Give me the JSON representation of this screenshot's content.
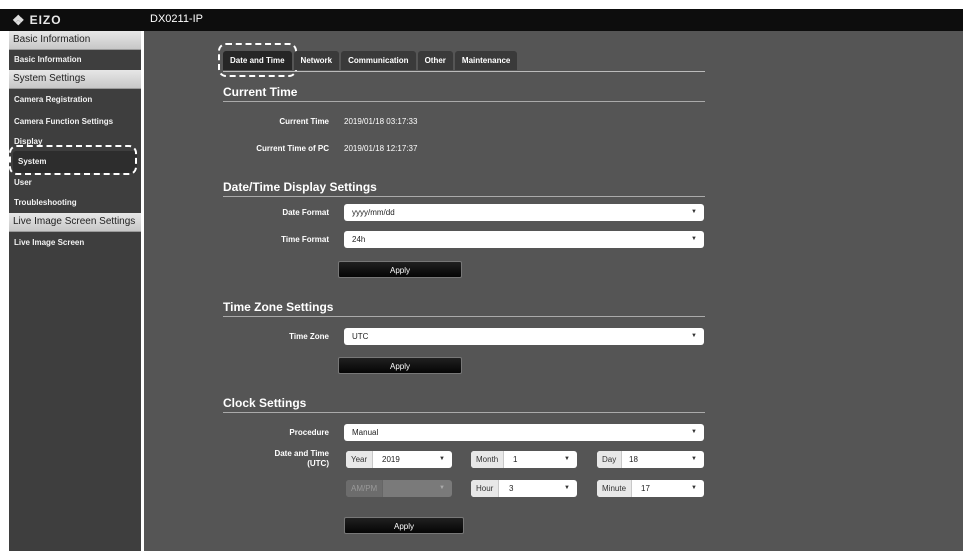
{
  "header": {
    "logo_text": "EIZO",
    "device_name": "DX0211-IP"
  },
  "sidebar": {
    "groups": [
      {
        "title": "Basic Information",
        "items": [
          "Basic Information"
        ]
      },
      {
        "title": "System Settings",
        "items": [
          "Camera Registration",
          "Camera Function Settings",
          "Display",
          "System",
          "User",
          "Troubleshooting"
        ]
      },
      {
        "title": "Live Image Screen Settings",
        "items": [
          "Live Image Screen"
        ]
      }
    ],
    "active_item": "System"
  },
  "tabs": [
    {
      "label": "Date and Time",
      "active": true
    },
    {
      "label": "Network",
      "active": false
    },
    {
      "label": "Communication",
      "active": false
    },
    {
      "label": "Other",
      "active": false
    },
    {
      "label": "Maintenance",
      "active": false
    }
  ],
  "current_time": {
    "title": "Current Time",
    "current_time_label": "Current Time",
    "current_time_value": "2019/01/18 03:17:33",
    "pc_time_label": "Current Time of PC",
    "pc_time_value": "2019/01/18 12:17:37"
  },
  "display_settings": {
    "title": "Date/Time Display Settings",
    "date_format_label": "Date Format",
    "date_format_value": "yyyy/mm/dd",
    "time_format_label": "Time Format",
    "time_format_value": "24h",
    "apply_label": "Apply"
  },
  "timezone": {
    "title": "Time Zone Settings",
    "label": "Time Zone",
    "value": "UTC",
    "apply_label": "Apply"
  },
  "clock": {
    "title": "Clock Settings",
    "procedure_label": "Procedure",
    "procedure_value": "Manual",
    "datetime_label_1": "Date and Time",
    "datetime_label_2": "(UTC)",
    "year_label": "Year",
    "year_value": "2019",
    "month_label": "Month",
    "month_value": "1",
    "day_label": "Day",
    "day_value": "18",
    "ampm_label": "AM/PM",
    "ampm_value": "",
    "hour_label": "Hour",
    "hour_value": "3",
    "minute_label": "Minute",
    "minute_value": "17",
    "apply_label": "Apply"
  },
  "colors": {
    "main_bg": "#555555",
    "sidebar_bg": "#3e3e3e",
    "topbar_bg": "#0d0d0d",
    "button_bg": "#111111"
  }
}
